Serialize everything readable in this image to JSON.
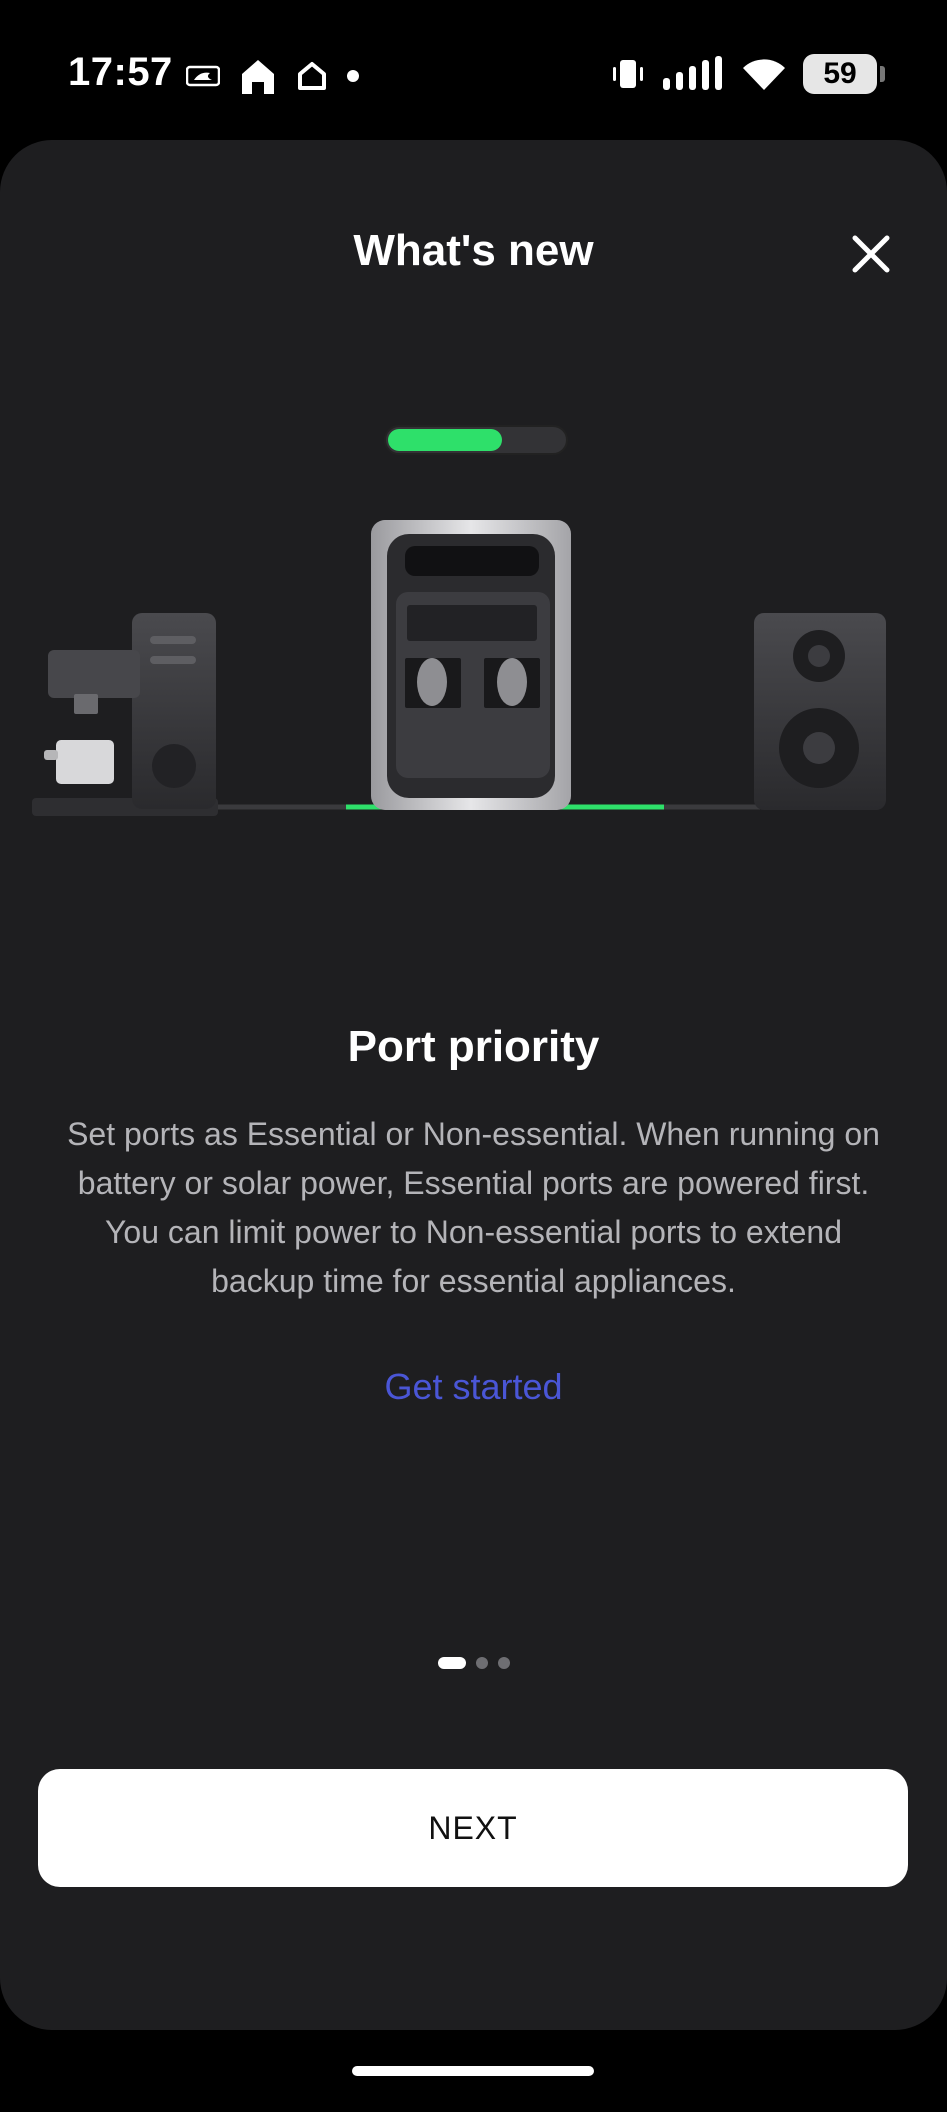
{
  "status_bar": {
    "time": "17:57",
    "battery_level": "59",
    "left_icons": [
      "mlb-icon",
      "home-icon",
      "home-outline-icon",
      "dot-icon"
    ],
    "right_icons": [
      "vibrate-icon",
      "signal-icon",
      "wifi-icon",
      "battery-icon"
    ]
  },
  "sheet": {
    "title": "What's new",
    "close_icon": "close-icon"
  },
  "illustration": {
    "charge_level_fraction": 0.65,
    "accent_color": "#2ee06a",
    "devices": [
      "coffee-machine",
      "power-station",
      "speaker"
    ]
  },
  "feature": {
    "title": "Port priority",
    "description": "Set ports as Essential or Non-essential. When running on battery or solar power, Essential ports are powered first. You can limit power to Non-essential ports to extend backup time for essential appliances.",
    "link_label": "Get started",
    "link_color": "#4a56d6"
  },
  "pager": {
    "total": 3,
    "current": 1
  },
  "next_button": {
    "label": "NEXT"
  }
}
